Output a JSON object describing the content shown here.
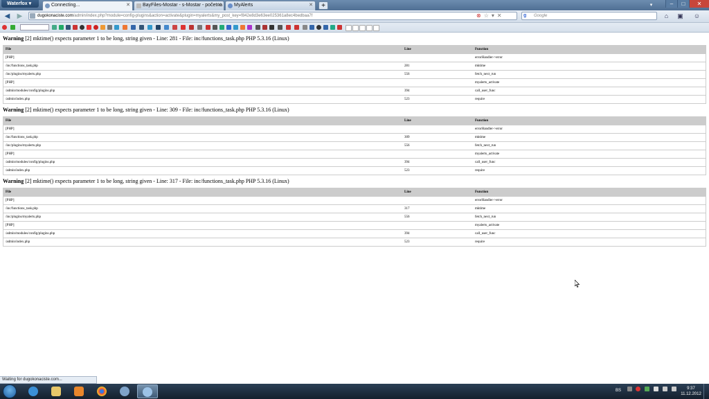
{
  "browser": {
    "app_name": "Waterfox",
    "tabs": [
      {
        "label": "Connecting...",
        "active": true
      },
      {
        "label": "BayFiles-Mostar - s-Mostar - početna",
        "active": false
      },
      {
        "label": "MyAlerts",
        "active": false
      }
    ],
    "new_tab": "+",
    "url": {
      "domain": "dugokonaciste.com",
      "path": "/admin/index.php?module=config-plugins&action=activate&plugin=myalerts&my_post_key=f842e8d3e63ee025361a8ec4bedbaa7f"
    },
    "search": {
      "engine_glyph": "g",
      "placeholder": "Google"
    },
    "status": "Waiting for dugokonaciste.com..."
  },
  "warnings": [
    {
      "label": "Warning",
      "message": "[2] mktime() expects parameter 1 to be long, string given - Line: 281 - File: inc/functions_task.php PHP 5.3.16 (Linux)",
      "columns": [
        "File",
        "Line",
        "Function"
      ],
      "rows": [
        [
          "[PHP]",
          "",
          "errorHandler->error"
        ],
        [
          "/inc/functions_task.php",
          "281",
          "mktime"
        ],
        [
          "/inc/plugins/myalerts.php",
          "556",
          "fetch_next_run"
        ],
        [
          "[PHP]",
          "",
          "myalerts_activate"
        ],
        [
          "/admin/modules/config/plugins.php",
          "394",
          "call_user_func"
        ],
        [
          "/admin/index.php",
          "523",
          "require"
        ]
      ]
    },
    {
      "label": "Warning",
      "message": "[2] mktime() expects parameter 1 to be long, string given - Line: 309 - File: inc/functions_task.php PHP 5.3.16 (Linux)",
      "columns": [
        "File",
        "Line",
        "Function"
      ],
      "rows": [
        [
          "[PHP]",
          "",
          "errorHandler->error"
        ],
        [
          "/inc/functions_task.php",
          "309",
          "mktime"
        ],
        [
          "/inc/plugins/myalerts.php",
          "556",
          "fetch_next_run"
        ],
        [
          "[PHP]",
          "",
          "myalerts_activate"
        ],
        [
          "/admin/modules/config/plugins.php",
          "394",
          "call_user_func"
        ],
        [
          "/admin/index.php",
          "523",
          "require"
        ]
      ]
    },
    {
      "label": "Warning",
      "message": "[2] mktime() expects parameter 1 to be long, string given - Line: 317 - File: inc/functions_task.php PHP 5.3.16 (Linux)",
      "columns": [
        "File",
        "Line",
        "Function"
      ],
      "rows": [
        [
          "[PHP]",
          "",
          "errorHandler->error"
        ],
        [
          "/inc/functions_task.php",
          "317",
          "mktime"
        ],
        [
          "/inc/plugins/myalerts.php",
          "556",
          "fetch_next_run"
        ],
        [
          "[PHP]",
          "",
          "myalerts_activate"
        ],
        [
          "/admin/modules/config/plugins.php",
          "394",
          "call_user_func"
        ],
        [
          "/admin/index.php",
          "523",
          "require"
        ]
      ]
    }
  ],
  "taskbar": {
    "language": "BS",
    "time": "9:37",
    "date": "11.12.2012",
    "apps": [
      "internet-explorer",
      "file-explorer",
      "media-player",
      "chrome",
      "network-tool",
      "waterfox"
    ]
  },
  "colors": {
    "table_header": "#cccccc",
    "taskbar": "#1d2b3a"
  }
}
